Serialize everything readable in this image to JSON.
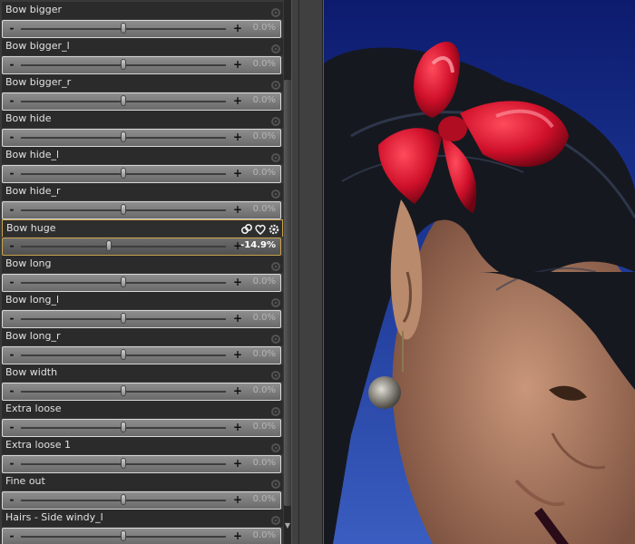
{
  "morph_list": {
    "items": [
      {
        "label": "Bow bigger",
        "value": "0.0%",
        "pos": 0.5
      },
      {
        "label": "Bow bigger_l",
        "value": "0.0%",
        "pos": 0.5
      },
      {
        "label": "Bow bigger_r",
        "value": "0.0%",
        "pos": 0.5
      },
      {
        "label": "Bow hide",
        "value": "0.0%",
        "pos": 0.5
      },
      {
        "label": "Bow hide_l",
        "value": "0.0%",
        "pos": 0.5
      },
      {
        "label": "Bow hide_r",
        "value": "0.0%",
        "pos": 0.5
      },
      {
        "label": "Bow huge",
        "value": "-14.9%",
        "pos": 0.43,
        "selected": true
      },
      {
        "label": "Bow long",
        "value": "0.0%",
        "pos": 0.5
      },
      {
        "label": "Bow long_l",
        "value": "0.0%",
        "pos": 0.5
      },
      {
        "label": "Bow long_r",
        "value": "0.0%",
        "pos": 0.5
      },
      {
        "label": "Bow width",
        "value": "0.0%",
        "pos": 0.5
      },
      {
        "label": "Extra loose",
        "value": "0.0%",
        "pos": 0.5
      },
      {
        "label": "Extra loose 1",
        "value": "0.0%",
        "pos": 0.5
      },
      {
        "label": "Fine out",
        "value": "0.0%",
        "pos": 0.5
      },
      {
        "label": "Hairs - Side windy_l",
        "value": "0.0%",
        "pos": 0.5
      }
    ],
    "minus_label": "-",
    "plus_label": "+",
    "selected_actions": [
      "link-icon",
      "heart-icon",
      "gear-icon"
    ]
  },
  "colors": {
    "panel_bg": "#3a3a3a",
    "header_bg": "#2b2b2b",
    "selection_border": "#caa24a",
    "bow_red": "#d0102a",
    "sky_blue": "#1a3490",
    "hair": "#111318",
    "skin": "#b78a6e"
  }
}
